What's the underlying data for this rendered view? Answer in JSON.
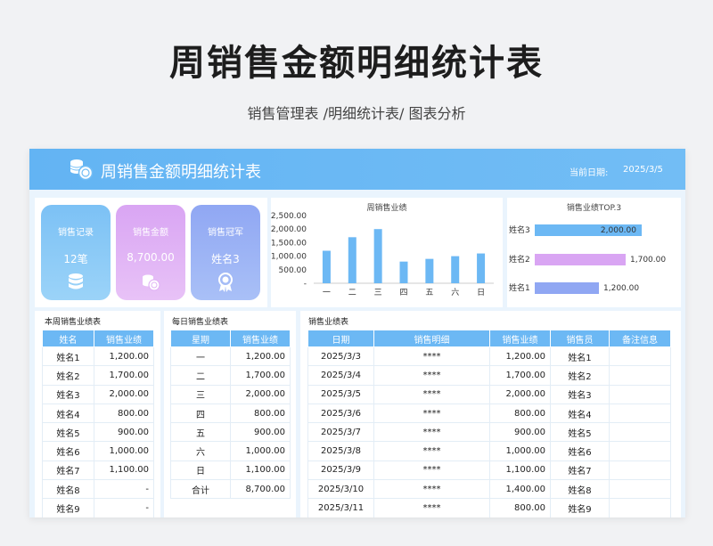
{
  "header": {
    "title": "周销售金额明细统计表",
    "subtitle": "销售管理表 /明细统计表/ 图表分析"
  },
  "banner": {
    "title": "周销售金额明细统计表",
    "date_label": "当前日期:",
    "date_value": "2025/3/5",
    "icon": "coins-icon"
  },
  "cards": [
    {
      "label": "销售记录",
      "value": "12笔",
      "icon": "database-icon",
      "color": "#7cc1f5"
    },
    {
      "label": "销售金额",
      "value": "8,700.00",
      "icon": "coins-icon",
      "color": "#d9a5f3"
    },
    {
      "label": "销售冠军",
      "value": "姓名3",
      "icon": "award-icon",
      "color": "#90a7f3"
    }
  ],
  "chart_data": [
    {
      "type": "bar",
      "title": "周销售业绩",
      "categories": [
        "一",
        "二",
        "三",
        "四",
        "五",
        "六",
        "日"
      ],
      "values": [
        1200,
        1700,
        2000,
        800,
        900,
        1000,
        1100
      ],
      "ylim": [
        0,
        2500
      ],
      "yticks": [
        "2,500.00",
        "2,000.00",
        "1,500.00",
        "1,000.00",
        "500.00",
        "-"
      ],
      "color": "#6cb8f4"
    },
    {
      "type": "bar",
      "orientation": "horizontal",
      "title": "销售业绩TOP.3",
      "categories": [
        "姓名3",
        "姓名2",
        "姓名1"
      ],
      "values": [
        2000,
        1700,
        1200
      ],
      "labels": [
        "2,000.00",
        "1,700.00",
        "1,200.00"
      ],
      "colors": [
        "#6cb8f4",
        "#d9a5f3",
        "#90a7f3"
      ],
      "xlim": [
        0,
        2000
      ]
    }
  ],
  "weekly_table": {
    "title": "本周销售业绩表",
    "headers": [
      "姓名",
      "销售业绩"
    ],
    "rows": [
      [
        "姓名1",
        "1,200.00"
      ],
      [
        "姓名2",
        "1,700.00"
      ],
      [
        "姓名3",
        "2,000.00"
      ],
      [
        "姓名4",
        "800.00"
      ],
      [
        "姓名5",
        "900.00"
      ],
      [
        "姓名6",
        "1,000.00"
      ],
      [
        "姓名7",
        "1,100.00"
      ],
      [
        "姓名8",
        "-"
      ],
      [
        "姓名9",
        "-"
      ]
    ]
  },
  "daily_table": {
    "title": "每日销售业绩表",
    "headers": [
      "星期",
      "销售业绩"
    ],
    "rows": [
      [
        "一",
        "1,200.00"
      ],
      [
        "二",
        "1,700.00"
      ],
      [
        "三",
        "2,000.00"
      ],
      [
        "四",
        "800.00"
      ],
      [
        "五",
        "900.00"
      ],
      [
        "六",
        "1,000.00"
      ],
      [
        "日",
        "1,100.00"
      ],
      [
        "合计",
        "8,700.00"
      ]
    ]
  },
  "sales_table": {
    "title": "销售业绩表",
    "headers": [
      "日期",
      "销售明细",
      "销售业绩",
      "销售员",
      "备注信息"
    ],
    "rows": [
      [
        "2025/3/3",
        "****",
        "1,200.00",
        "姓名1",
        ""
      ],
      [
        "2025/3/4",
        "****",
        "1,700.00",
        "姓名2",
        ""
      ],
      [
        "2025/3/5",
        "****",
        "2,000.00",
        "姓名3",
        ""
      ],
      [
        "2025/3/6",
        "****",
        "800.00",
        "姓名4",
        ""
      ],
      [
        "2025/3/7",
        "****",
        "900.00",
        "姓名5",
        ""
      ],
      [
        "2025/3/8",
        "****",
        "1,000.00",
        "姓名6",
        ""
      ],
      [
        "2025/3/9",
        "****",
        "1,100.00",
        "姓名7",
        ""
      ],
      [
        "2025/3/10",
        "****",
        "1,400.00",
        "姓名8",
        ""
      ],
      [
        "2025/3/11",
        "****",
        "800.00",
        "姓名9",
        ""
      ]
    ]
  }
}
